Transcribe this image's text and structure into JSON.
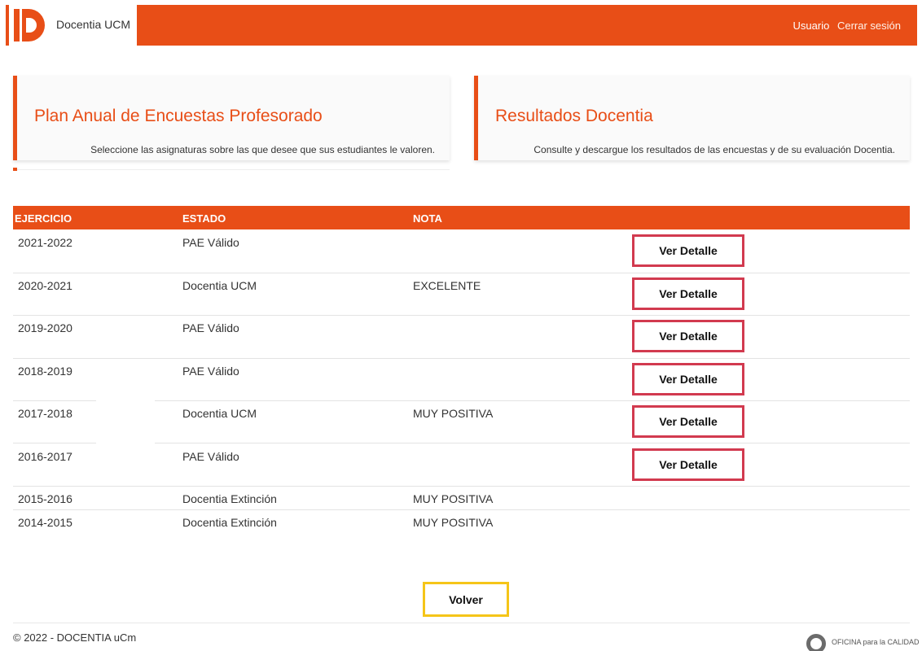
{
  "colors": {
    "accent": "#e84e17",
    "detail_border": "#d23a4f",
    "back_border": "#f5c518"
  },
  "header": {
    "logo_text": "Docentia UCM",
    "user_label": "Usuario",
    "logout_label": "Cerrar sesión"
  },
  "cards": [
    {
      "title": "Plan Anual de Encuestas Profesorado",
      "subtitle": "Seleccione las asignaturas sobre las que desee que sus estudiantes le valoren."
    },
    {
      "title": "Resultados Docentia",
      "subtitle": "Consulte y descargue los resultados de las encuestas y de su evaluación Docentia."
    }
  ],
  "table": {
    "headers": {
      "ejercicio": "EJERCICIO",
      "estado": "ESTADO",
      "nota": "NOTA"
    },
    "rows": [
      {
        "ejercicio": "2021-2022",
        "estado": "PAE Válido",
        "nota": "",
        "action": "Ver Detalle"
      },
      {
        "ejercicio": "2020-2021",
        "estado": "Docentia UCM",
        "nota": "EXCELENTE",
        "action": "Ver Detalle"
      },
      {
        "ejercicio": "2019-2020",
        "estado": "PAE Válido",
        "nota": "",
        "action": "Ver Detalle"
      },
      {
        "ejercicio": "2018-2019",
        "estado": "PAE Válido",
        "nota": "",
        "action": "Ver Detalle"
      },
      {
        "ejercicio": "2017-2018",
        "estado": "Docentia UCM",
        "nota": "MUY POSITIVA",
        "action": "Ver Detalle"
      },
      {
        "ejercicio": "2016-2017",
        "estado": "PAE Válido",
        "nota": "",
        "action": "Ver Detalle"
      },
      {
        "ejercicio": "2015-2016",
        "estado": "Docentia Extinción",
        "nota": "MUY POSITIVA",
        "action": ""
      },
      {
        "ejercicio": "2014-2015",
        "estado": "Docentia Extinción",
        "nota": "MUY POSITIVA",
        "action": ""
      }
    ]
  },
  "back_label": "Volver",
  "footer": {
    "copyright": "© 2022 - DOCENTIA uCm",
    "office_logo_text": "OFICINA para la CALIDAD"
  }
}
